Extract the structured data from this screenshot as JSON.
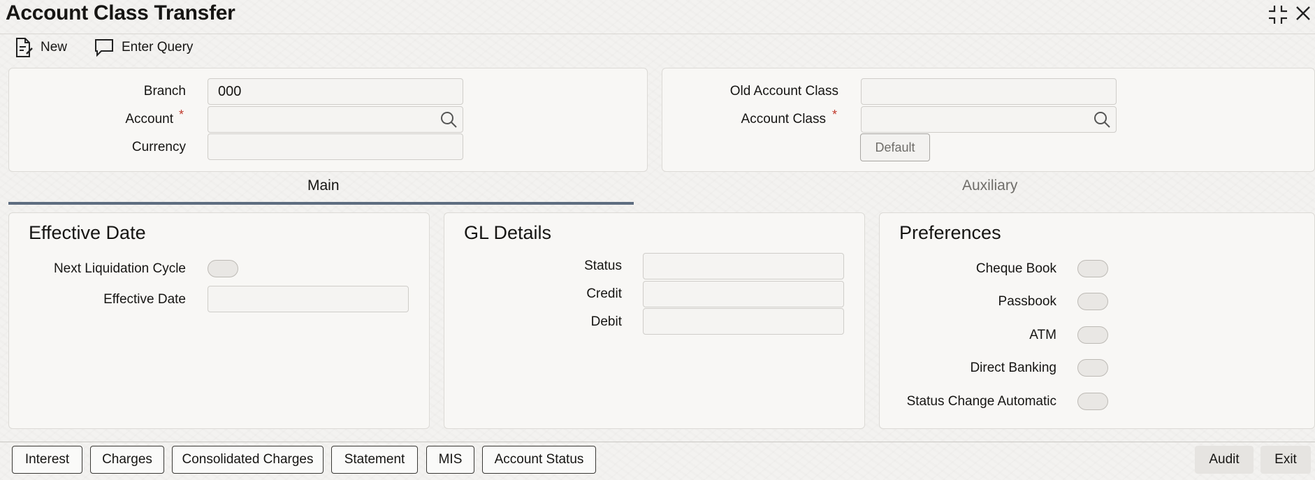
{
  "window": {
    "title": "Account Class Transfer",
    "controls": {
      "maximize_glyph": "⛶",
      "close_glyph": "✕"
    }
  },
  "toolbar": {
    "new_label": "New",
    "enter_query_label": "Enter Query"
  },
  "header_left": {
    "branch_label": "Branch",
    "branch_value": "000",
    "account_label": "Account",
    "account_required": "*",
    "account_value": "",
    "currency_label": "Currency",
    "currency_value": ""
  },
  "header_right": {
    "old_account_class_label": "Old Account Class",
    "old_account_class_value": "",
    "account_class_label": "Account Class",
    "account_class_required": "*",
    "account_class_value": "",
    "default_button": "Default"
  },
  "tabs": [
    {
      "label": "Main",
      "active": true
    },
    {
      "label": "Auxiliary",
      "active": false
    }
  ],
  "effective_date": {
    "title": "Effective Date",
    "next_liquidation_label": "Next Liquidation Cycle",
    "next_liquidation_on": false,
    "effective_date_label": "Effective Date",
    "effective_date_value": ""
  },
  "gl_details": {
    "title": "GL Details",
    "status_label": "Status",
    "status_value": "",
    "credit_label": "Credit",
    "credit_value": "",
    "debit_label": "Debit",
    "debit_value": ""
  },
  "preferences": {
    "title": "Preferences",
    "items": [
      {
        "label": "Cheque Book",
        "on": false
      },
      {
        "label": "Passbook",
        "on": false
      },
      {
        "label": "ATM",
        "on": false
      },
      {
        "label": "Direct Banking",
        "on": false
      },
      {
        "label": "Status Change Automatic",
        "on": false
      }
    ]
  },
  "footer": {
    "buttons": [
      "Interest",
      "Charges",
      "Consolidated Charges",
      "Statement",
      "MIS",
      "Account Status"
    ],
    "audit_label": "Audit",
    "exit_label": "Exit"
  },
  "colors": {
    "accent_tab": "#5e6d80",
    "required": "#c0392b",
    "panel_bg": "#f8f7f5"
  }
}
